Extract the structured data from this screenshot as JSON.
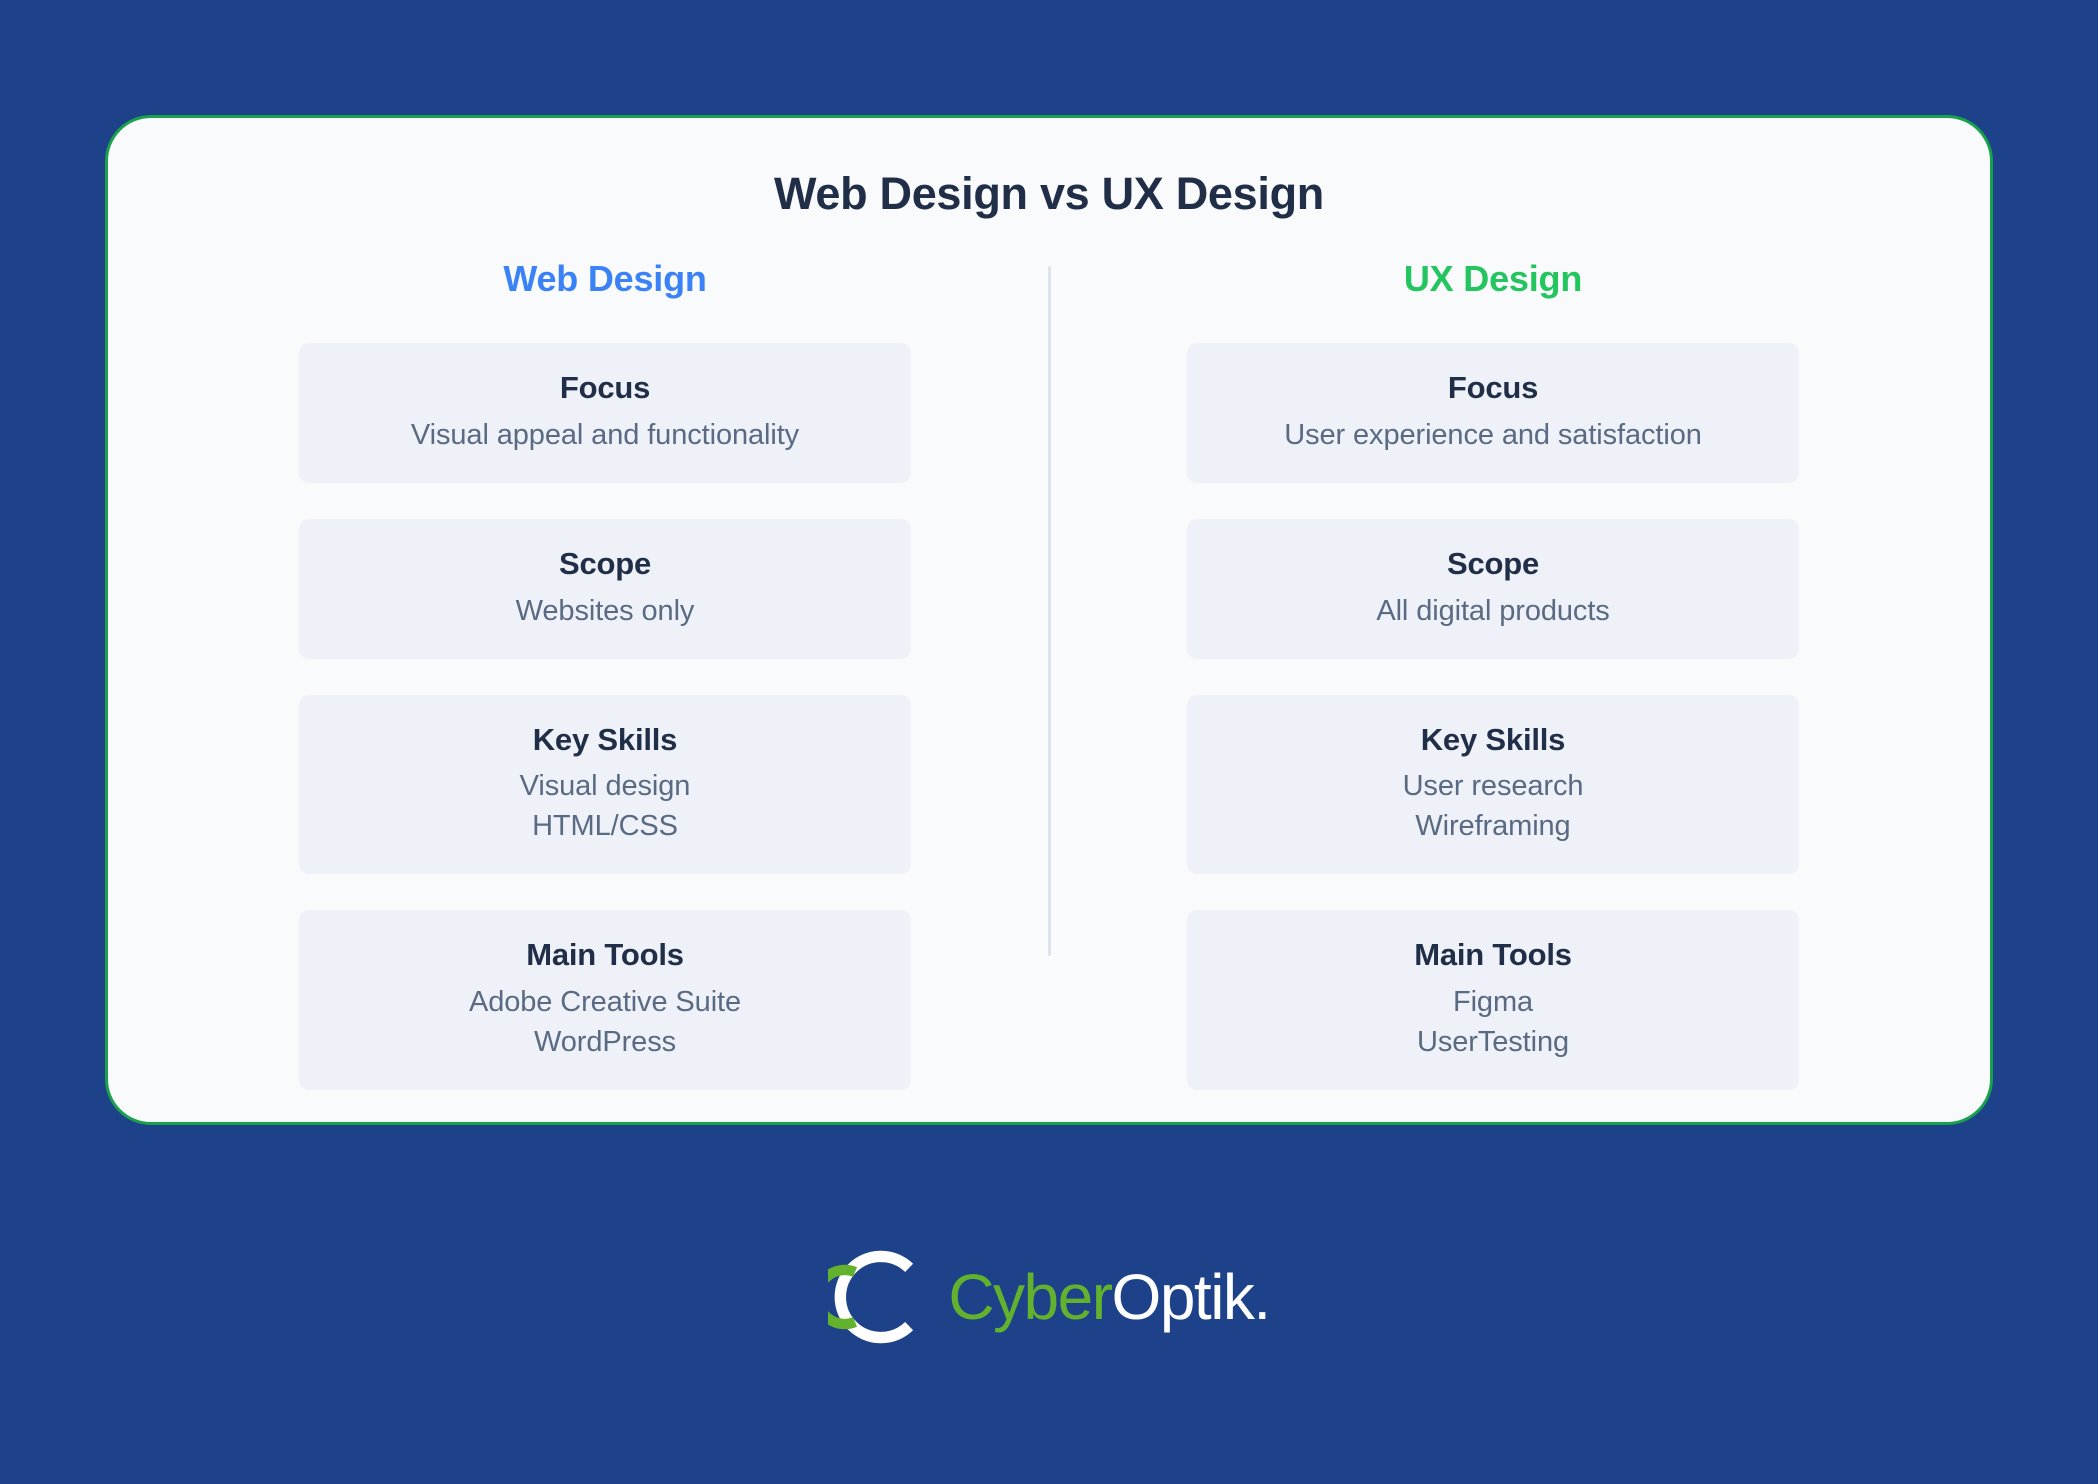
{
  "title": "Web Design vs UX Design",
  "columns": [
    {
      "heading": "Web Design",
      "color": "#3b82f6",
      "rows": [
        {
          "label": "Focus",
          "values": [
            "Visual appeal and functionality"
          ]
        },
        {
          "label": "Scope",
          "values": [
            "Websites only"
          ]
        },
        {
          "label": "Key Skills",
          "values": [
            "Visual design",
            "HTML/CSS"
          ]
        },
        {
          "label": "Main Tools",
          "values": [
            "Adobe Creative Suite",
            "WordPress"
          ]
        }
      ]
    },
    {
      "heading": "UX Design",
      "color": "#22c55e",
      "rows": [
        {
          "label": "Focus",
          "values": [
            "User experience and satisfaction"
          ]
        },
        {
          "label": "Scope",
          "values": [
            "All digital products"
          ]
        },
        {
          "label": "Key Skills",
          "values": [
            "User research",
            "Wireframing"
          ]
        },
        {
          "label": "Main Tools",
          "values": [
            "Figma",
            "UserTesting"
          ]
        }
      ]
    }
  ],
  "footer": {
    "brand_primary": "Cyber",
    "brand_secondary": "Optik.",
    "logo_outer_color": "#ffffff",
    "logo_inner_color": "#63b22e"
  },
  "theme": {
    "background": "#1e4289",
    "panel_background": "#f8fafc",
    "panel_border": "#19a14b",
    "card_background": "#eef2f8",
    "heading_text": "#212e47",
    "body_text": "#5a6a83",
    "divider": "#dde3ec"
  }
}
